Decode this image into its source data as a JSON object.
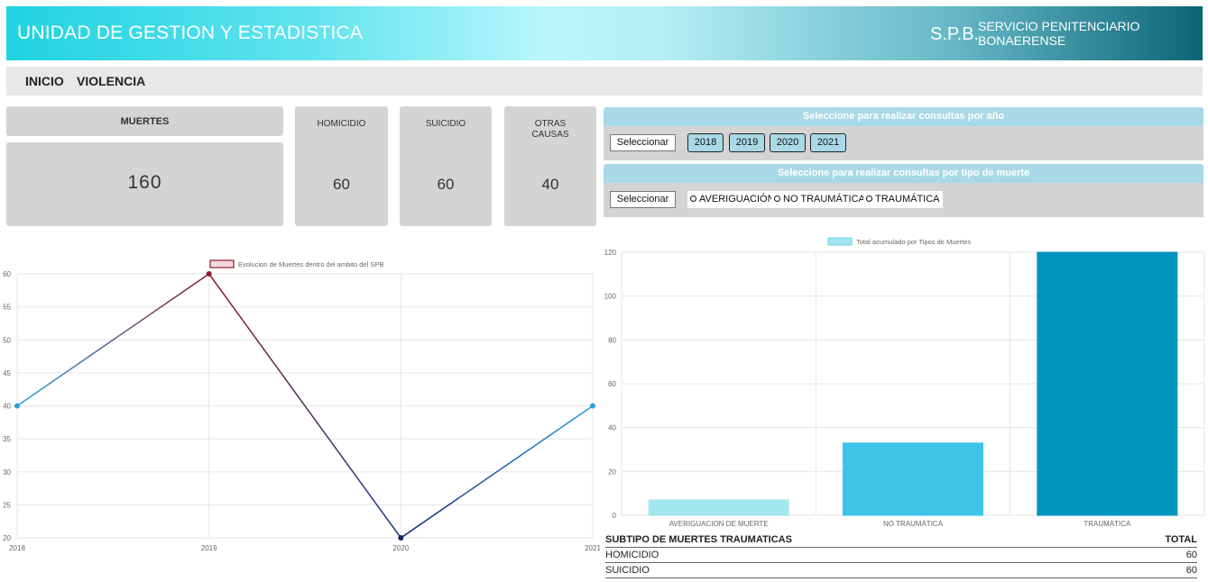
{
  "header": {
    "title": "UNIDAD DE GESTION Y ESTADISTICA",
    "abbr": "S.P.B.",
    "org_line1": "SERVICIO PENITENCIARIO",
    "org_line2": "BONAERENSE"
  },
  "nav": {
    "items": [
      "INICIO",
      "VIOLENCIA"
    ]
  },
  "cards": {
    "muertes_label": "MUERTES",
    "muertes_value": "160",
    "homicidio_label": "HOMICIDIO",
    "homicidio_value": "60",
    "suicidio_label": "SUICIDIO",
    "suicidio_value": "60",
    "otras_label1": "OTRAS",
    "otras_label2": "CAUSAS",
    "otras_value": "40"
  },
  "filters": {
    "year_title": "Seleccione para realizar consultas por año",
    "type_title": "Seleccione para realizar consultas por tipo de muerte",
    "select_label": "Seleccionar",
    "years": [
      "2018",
      "2019",
      "2020",
      "2021"
    ],
    "types": [
      "AVERIGUACIÓN",
      "NO TRAUMÁTICA",
      "TRAUMÁTICA"
    ]
  },
  "chart_data": [
    {
      "type": "line",
      "legend": "Evolucion de Muertes dentro del ambito del SPB",
      "x": [
        "2018",
        "2019",
        "2020",
        "2021"
      ],
      "values": [
        40,
        60,
        20,
        40
      ],
      "ylim": [
        20,
        60
      ],
      "yticks": [
        20,
        25,
        30,
        35,
        40,
        45,
        50,
        55,
        60
      ],
      "grid": true,
      "legend_position": "top"
    },
    {
      "type": "bar",
      "legend": "Total acumulado por Tipos de Muertes",
      "categories": [
        "AVERIGUACION DE MUERTE",
        "NO TRAUMÁTICA",
        "TRAUMÁTICA"
      ],
      "values": [
        7,
        33,
        120
      ],
      "colors": [
        "#a3e6f0",
        "#3ec4e8",
        "#0096bd"
      ],
      "ylim": [
        0,
        120
      ],
      "yticks": [
        0,
        20,
        40,
        60,
        80,
        100,
        120
      ],
      "grid": true,
      "legend_position": "top"
    }
  ],
  "table": {
    "header_left": "SUBTIPO DE MUERTES TRAUMATICAS",
    "header_right": "TOTAL",
    "rows": [
      {
        "label": "HOMICIDIO",
        "value": "60"
      },
      {
        "label": "SUICIDIO",
        "value": "60"
      }
    ]
  }
}
